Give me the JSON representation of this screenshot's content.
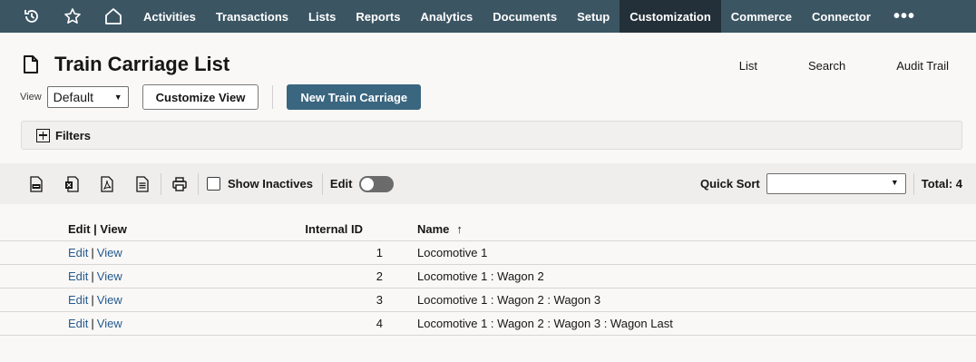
{
  "nav": {
    "icons": [
      "recent-icon",
      "star-icon",
      "home-icon"
    ],
    "items": [
      "Activities",
      "Transactions",
      "Lists",
      "Reports",
      "Analytics",
      "Documents",
      "Setup",
      "Customization",
      "Commerce",
      "Connector"
    ],
    "active": "Customization",
    "more": "•••"
  },
  "page": {
    "title": "Train Carriage List",
    "links": [
      "List",
      "Search",
      "Audit Trail"
    ]
  },
  "view": {
    "label": "View",
    "selected": "Default",
    "customize_label": "Customize View",
    "new_label": "New Train Carriage"
  },
  "filters": {
    "label": "Filters"
  },
  "toolbar": {
    "icons": [
      "csv-export-icon",
      "excel-export-icon",
      "pdf-export-icon",
      "document-export-icon",
      "print-icon"
    ],
    "show_inactives_label": "Show Inactives",
    "edit_label": "Edit",
    "edit_toggle_on": false,
    "quick_sort_label": "Quick Sort",
    "quick_sort_value": "",
    "total_label": "Total: 4"
  },
  "table": {
    "headers": {
      "edit_view": "Edit | View",
      "internal_id": "Internal ID",
      "name": "Name",
      "sort_arrow": "↑"
    },
    "rows": [
      {
        "edit": "Edit",
        "view": "View",
        "id": "1",
        "name": "Locomotive 1"
      },
      {
        "edit": "Edit",
        "view": "View",
        "id": "2",
        "name": "Locomotive 1 : Wagon 2"
      },
      {
        "edit": "Edit",
        "view": "View",
        "id": "3",
        "name": "Locomotive 1 : Wagon 2 : Wagon 3"
      },
      {
        "edit": "Edit",
        "view": "View",
        "id": "4",
        "name": "Locomotive 1 : Wagon 2 : Wagon 3 : Wagon Last"
      }
    ]
  },
  "colors": {
    "nav_bg": "#3b5563",
    "nav_active": "#233039",
    "primary_button": "#3b6680",
    "link": "#255a8f"
  }
}
